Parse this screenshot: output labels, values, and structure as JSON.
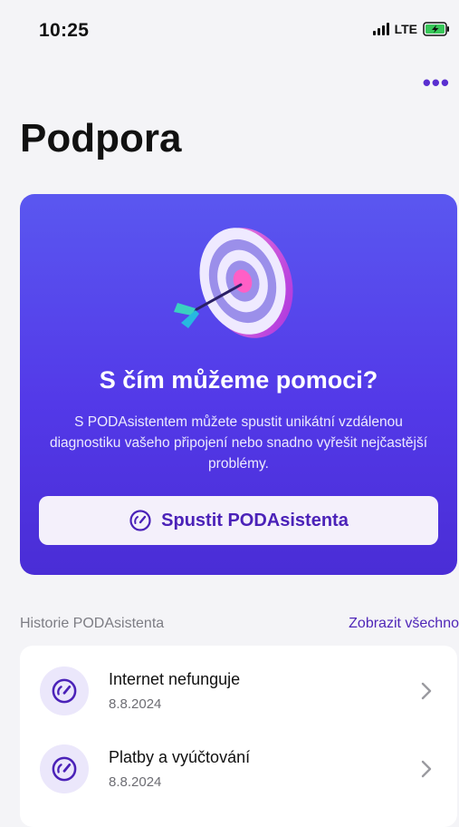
{
  "status_bar": {
    "time": "10:25",
    "network": "LTE"
  },
  "header": {
    "title": "Podpora",
    "more_label": "•••"
  },
  "hero": {
    "heading": "S čím můžeme pomoci?",
    "description": "S PODAsistentem můžete spustit unikátní vzdálenou diagnostiku vašeho připojení nebo snadno vyřešit nejčastější problémy.",
    "button_label": "Spustit PODAsistenta"
  },
  "history": {
    "title": "Historie PODAsistenta",
    "show_all": "Zobrazit všechno",
    "items": [
      {
        "title": "Internet nefunguje",
        "date": "8.8.2024",
        "icon": "speedometer-icon"
      },
      {
        "title": "Platby a vyúčtování",
        "date": "8.8.2024",
        "icon": "speedometer-icon"
      }
    ]
  },
  "colors": {
    "accent": "#5a2fd0",
    "hero_top": "#5a57f0",
    "hero_bottom": "#4a2dd6",
    "battery": "#38c759"
  }
}
